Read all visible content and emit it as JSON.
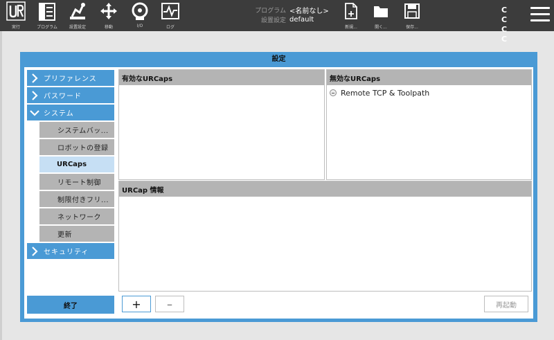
{
  "topbar": {
    "nav": [
      {
        "label": "実行",
        "icon": "ur-logo-icon"
      },
      {
        "label": "プログラム",
        "icon": "program-icon"
      },
      {
        "label": "設置設定",
        "icon": "installation-icon"
      },
      {
        "label": "移動",
        "icon": "move-icon"
      },
      {
        "label": "I/O",
        "icon": "io-icon"
      },
      {
        "label": "ログ",
        "icon": "log-icon"
      }
    ],
    "program_key": "プログラム",
    "program_value": "<名前なし>",
    "installation_key": "設置設定",
    "installation_value": "default",
    "file_actions": [
      {
        "label": "新規...",
        "icon": "new-file-icon"
      },
      {
        "label": "開く...",
        "icon": "open-folder-icon"
      },
      {
        "label": "保存...",
        "icon": "save-icon"
      }
    ],
    "status_row1": "C C",
    "status_row2": "C C",
    "menu_icon": "hamburger-menu-icon"
  },
  "dialog": {
    "title": "設定",
    "sidebar": {
      "main_items": [
        {
          "label": "プリファレンス",
          "state": "collapsed"
        },
        {
          "label": "パスワード",
          "state": "collapsed"
        },
        {
          "label": "システム",
          "state": "expanded"
        },
        {
          "label": "セキュリティ",
          "state": "collapsed"
        }
      ],
      "sub_items": [
        {
          "label": "システムバッ..."
        },
        {
          "label": "ロボットの登録"
        },
        {
          "label": "URCaps",
          "active": true
        },
        {
          "label": "リモート制御"
        },
        {
          "label": "制限付きフリ..."
        },
        {
          "label": "ネットワーク"
        },
        {
          "label": "更新"
        }
      ],
      "finish_label": "終了"
    },
    "active_panel": {
      "title": "有効なURCaps",
      "items": []
    },
    "inactive_panel": {
      "title": "無効なURCaps",
      "items": [
        "Remote TCP & Toolpath"
      ]
    },
    "info_panel": {
      "title": "URCap 情報"
    },
    "buttons": {
      "add": "+",
      "remove": "–",
      "restart": "再起動"
    }
  },
  "colors": {
    "accent": "#4a9ad5",
    "topbar": "#3c3c3c",
    "subnav": "#b4b4b4",
    "subnav_active": "#c6dff4"
  }
}
